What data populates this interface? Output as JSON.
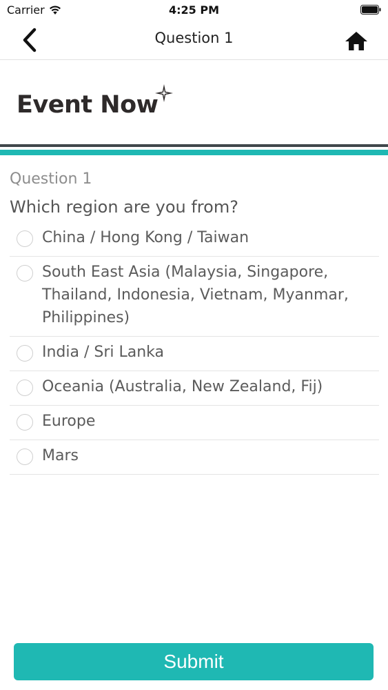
{
  "status_bar": {
    "carrier": "Carrier",
    "time": "4:25 PM"
  },
  "nav": {
    "title": "Question 1",
    "back_icon": "chevron-left-icon",
    "home_icon": "home-icon"
  },
  "logo": {
    "text": "Event Now",
    "mark": "sparkle-icon"
  },
  "question": {
    "number": "Question 1",
    "text": "Which region are you from?",
    "options": [
      {
        "label": "China / Hong Kong / Taiwan"
      },
      {
        "label": "South East Asia (Malaysia, Singapore, Thailand, Indonesia, Vietnam, Myanmar, Philippines)"
      },
      {
        "label": "India / Sri Lanka"
      },
      {
        "label": "Oceania (Australia, New Zealand, Fij)"
      },
      {
        "label": "Europe"
      },
      {
        "label": "Mars"
      }
    ]
  },
  "submit": {
    "label": "Submit"
  },
  "colors": {
    "accent": "#1fb8b3",
    "divider_dark": "#3f474b"
  }
}
